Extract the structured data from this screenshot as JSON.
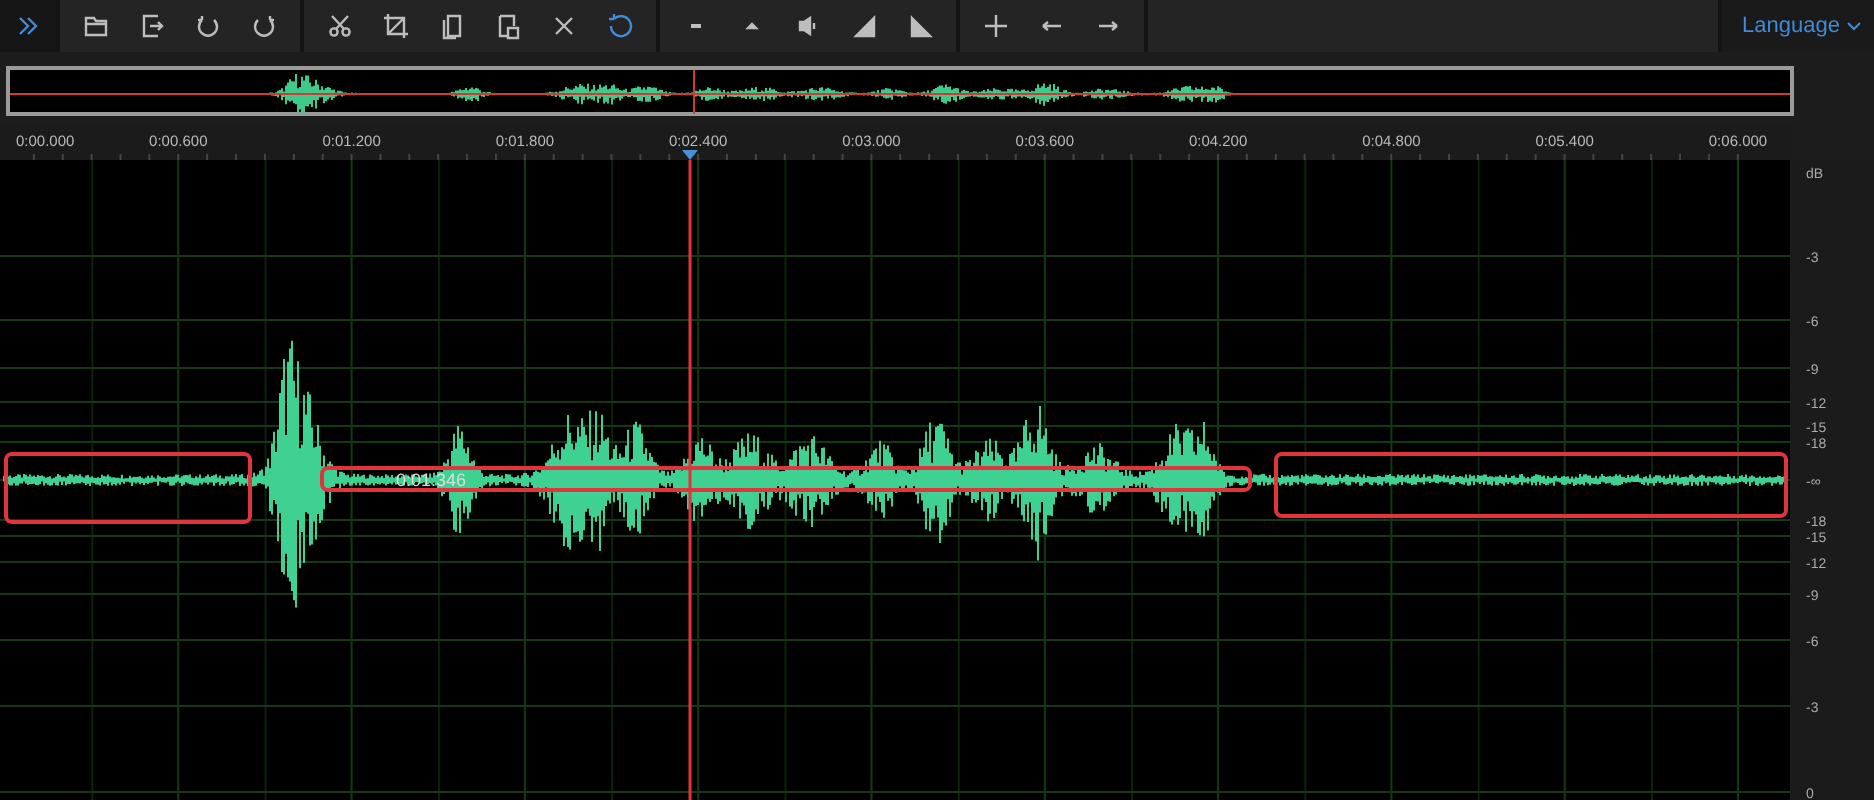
{
  "toolbar": {
    "groups": [
      {
        "items": [
          {
            "kind": "expand",
            "active": true
          }
        ]
      },
      {
        "items": [
          {
            "kind": "open",
            "active": false
          },
          {
            "kind": "export",
            "active": false
          },
          {
            "kind": "undo",
            "active": false
          },
          {
            "kind": "redo",
            "active": false
          }
        ]
      },
      {
        "items": [
          {
            "kind": "cut",
            "active": false
          },
          {
            "kind": "crop",
            "active": false
          },
          {
            "kind": "copy",
            "active": false
          },
          {
            "kind": "paste",
            "active": false
          },
          {
            "kind": "delete",
            "active": false
          },
          {
            "kind": "reset",
            "active": true
          }
        ]
      },
      {
        "items": [
          {
            "kind": "down",
            "active": false
          },
          {
            "kind": "up",
            "active": false
          },
          {
            "kind": "volume",
            "active": false
          },
          {
            "kind": "fade-in",
            "active": false
          },
          {
            "kind": "fade-out",
            "active": false
          }
        ]
      },
      {
        "items": [
          {
            "kind": "add",
            "active": false
          },
          {
            "kind": "left",
            "active": false
          },
          {
            "kind": "right",
            "active": false
          }
        ]
      }
    ],
    "language": "Language"
  },
  "timeline": {
    "ticks": [
      "0:00.000",
      "0:00.600",
      "0:01.200",
      "0:01.800",
      "0:02.400",
      "0:03.000",
      "0:03.600",
      "0:04.200",
      "0:04.800",
      "0:05.400",
      "0:06.000"
    ]
  },
  "regions": [
    {
      "kind": "selection"
    },
    {
      "kind": "selection",
      "label": "0:01.346"
    },
    {
      "kind": "selection"
    }
  ],
  "db_scale": {
    "unit": "dB",
    "labels": [
      "-3",
      "-6",
      "-9",
      "-12",
      "-15",
      "-18",
      "-∞",
      "-18",
      "-15",
      "-12",
      "-9",
      "-6",
      "-3",
      "0"
    ]
  }
}
